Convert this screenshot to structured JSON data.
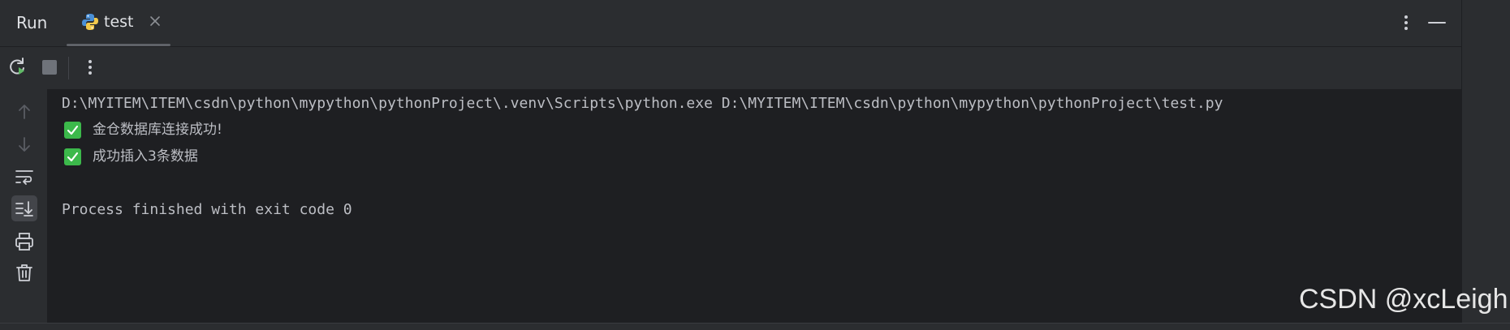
{
  "header": {
    "panel_title": "Run",
    "tab": {
      "label": "test",
      "icon": "python-file-icon"
    },
    "icons": [
      "more-vertical-icon",
      "minimize-icon"
    ]
  },
  "toolbar": {
    "icons": [
      "rerun-icon",
      "stop-icon",
      "more-vertical-icon"
    ]
  },
  "gutter": {
    "icons": [
      "arrow-up-icon",
      "arrow-down-icon",
      "soft-wrap-icon",
      "scroll-to-end-icon",
      "print-icon",
      "trash-icon"
    ]
  },
  "console": {
    "command": "D:\\MYITEM\\ITEM\\csdn\\python\\mypython\\pythonProject\\.venv\\Scripts\\python.exe D:\\MYITEM\\ITEM\\csdn\\python\\mypython\\pythonProject\\test.py",
    "messages": [
      "金仓数据库连接成功!",
      "成功插入3条数据"
    ],
    "exit_line": "Process finished with exit code 0"
  },
  "watermark": "CSDN @xcLeigh",
  "colors": {
    "panel_bg": "#2b2d30",
    "console_bg": "#1e1f22",
    "text": "#bcbec4",
    "check_green": "#3cb94b",
    "rerun_green": "#5fb865"
  }
}
